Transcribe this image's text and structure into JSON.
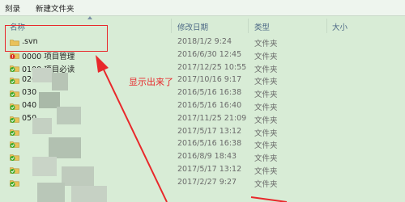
{
  "toolbar": {
    "burn_label": "刻录",
    "new_folder_label": "新建文件夹"
  },
  "columns": {
    "name": "名称",
    "date": "修改日期",
    "type": "类型",
    "size": "大小"
  },
  "rows": [
    {
      "name": ".svn",
      "date": "2018/1/2 9:24",
      "type": "文件夹",
      "icon": "folder-icon"
    },
    {
      "name": "0000 项目管理",
      "date": "2016/6/30 12:45",
      "type": "文件夹",
      "icon": "svn-conflict-folder-icon"
    },
    {
      "name": "0100 项目必读",
      "date": "2017/12/25 10:55",
      "type": "文件夹",
      "icon": "svn-ok-folder-icon"
    },
    {
      "name": "020",
      "date": "2017/10/16 9:17",
      "type": "文件夹",
      "icon": "svn-ok-folder-icon"
    },
    {
      "name": "030",
      "date": "2016/5/16 16:38",
      "type": "文件夹",
      "icon": "svn-ok-folder-icon"
    },
    {
      "name": "040",
      "date": "2016/5/16 16:40",
      "type": "文件夹",
      "icon": "svn-ok-folder-icon"
    },
    {
      "name": "050",
      "date": "2017/11/25 21:09",
      "type": "文件夹",
      "icon": "svn-ok-folder-icon"
    },
    {
      "name": "",
      "date": "2017/5/17 13:12",
      "type": "文件夹",
      "icon": "svn-ok-folder-icon"
    },
    {
      "name": "",
      "date": "2016/5/16 16:38",
      "type": "文件夹",
      "icon": "svn-ok-folder-icon"
    },
    {
      "name": "",
      "date": "2016/8/9 18:43",
      "type": "文件夹",
      "icon": "svn-ok-folder-icon"
    },
    {
      "name": "",
      "date": "2017/5/17 13:12",
      "type": "文件夹",
      "icon": "svn-ok-folder-icon"
    },
    {
      "name": "",
      "date": "2017/2/27 9:27",
      "type": "文件夹",
      "icon": "svn-ok-folder-icon"
    }
  ],
  "annotation": {
    "text": "显示出来了",
    "color": "#e8282b"
  },
  "colors": {
    "background": "#d8ecd6",
    "folder": "#e9c25a",
    "ok_badge": "#3aaa2c",
    "conflict_badge": "#d8322c"
  }
}
